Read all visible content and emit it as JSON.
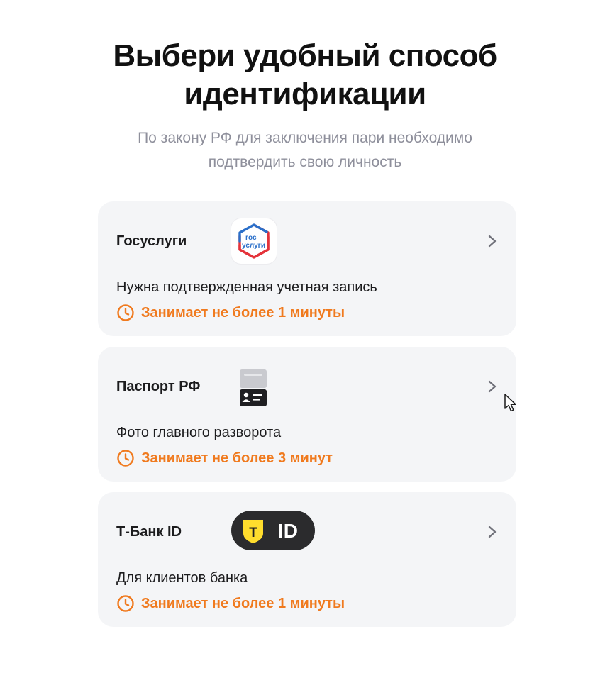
{
  "header": {
    "title": "Выбери удобный способ идентификации",
    "subtitle": "По закону РФ для заключения пари необходимо подтвердить свою личность"
  },
  "colors": {
    "accent": "#F07A1E",
    "card_bg": "#F4F5F7",
    "subtitle": "#8E8F9B",
    "text": "#1C1C1E"
  },
  "methods": [
    {
      "title": "Госуслуги",
      "description": "Нужна подтвержденная учетная запись",
      "time": "Занимает не более 1 минуты",
      "logo": "gosuslugi-logo",
      "logo_text": [
        "гос",
        "услуги"
      ]
    },
    {
      "title": "Паспорт РФ",
      "description": "Фото главного разворота",
      "time": "Занимает не более 3 минут",
      "logo": "passport-icon"
    },
    {
      "title": "Т-Банк ID",
      "description": "Для клиентов банка",
      "time": "Занимает не более 1 минуты",
      "logo": "tbank-id-logo",
      "logo_text": [
        "Т",
        "ID"
      ]
    }
  ]
}
